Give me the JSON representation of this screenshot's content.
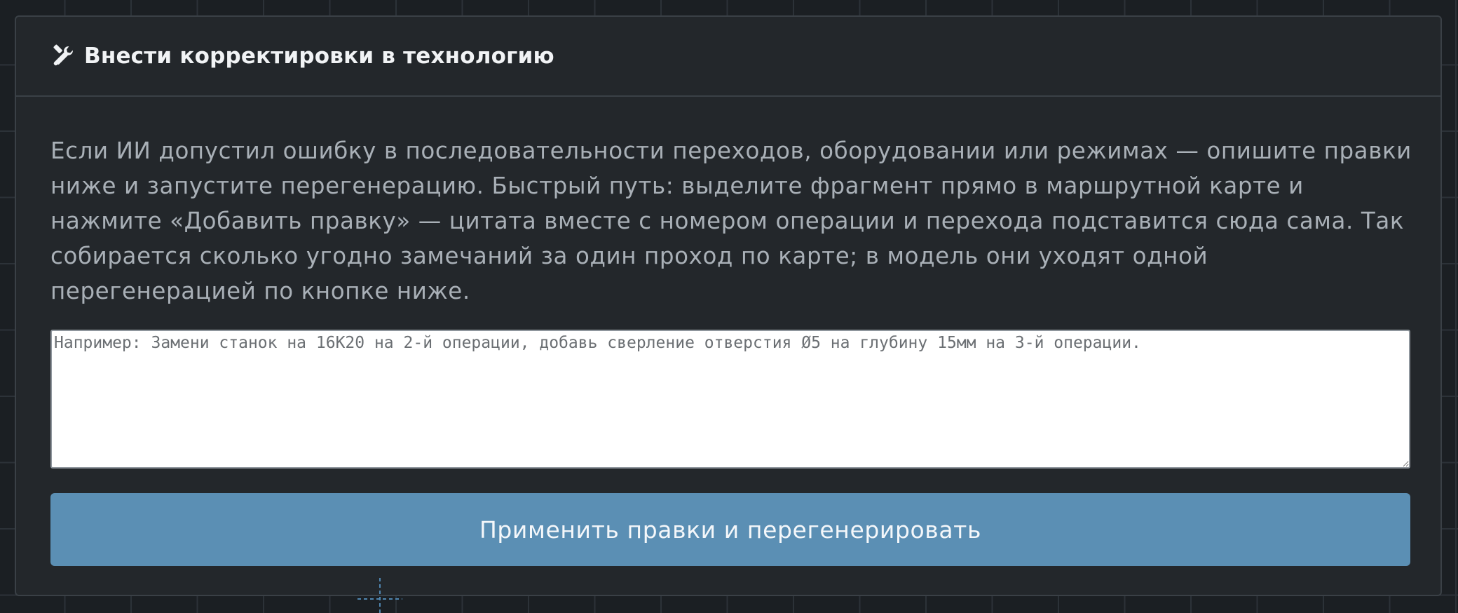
{
  "panel": {
    "title": "Внести корректировки в технологию",
    "title_icon": "tools-icon",
    "description": "Если ИИ допустил ошибку в последовательности переходов, оборудовании или режимах — опишите правки ниже и запустите перегенерацию. Быстрый путь: выделите фрагмент прямо в маршрутной карте и нажмите «Добавить правку» — цитата вместе с номером операции и перехода подставится сюда сама. Так собирается сколько угодно замечаний за один проход по карте; в модель они уходят одной перегенерацией по кнопке ниже.",
    "input": {
      "value": "",
      "placeholder": "Например: Замени станок на 16К20 на 2-й операции, добавь сверление отверстия Ø5 на глубину 15мм на 3-й операции."
    },
    "apply_button_label": "Применить правки и перегенерировать"
  },
  "colors": {
    "background": "#1b1f23",
    "panel": "#23272b",
    "button": "#5b8fb4",
    "accent_crosshair": "#4f86b0"
  }
}
